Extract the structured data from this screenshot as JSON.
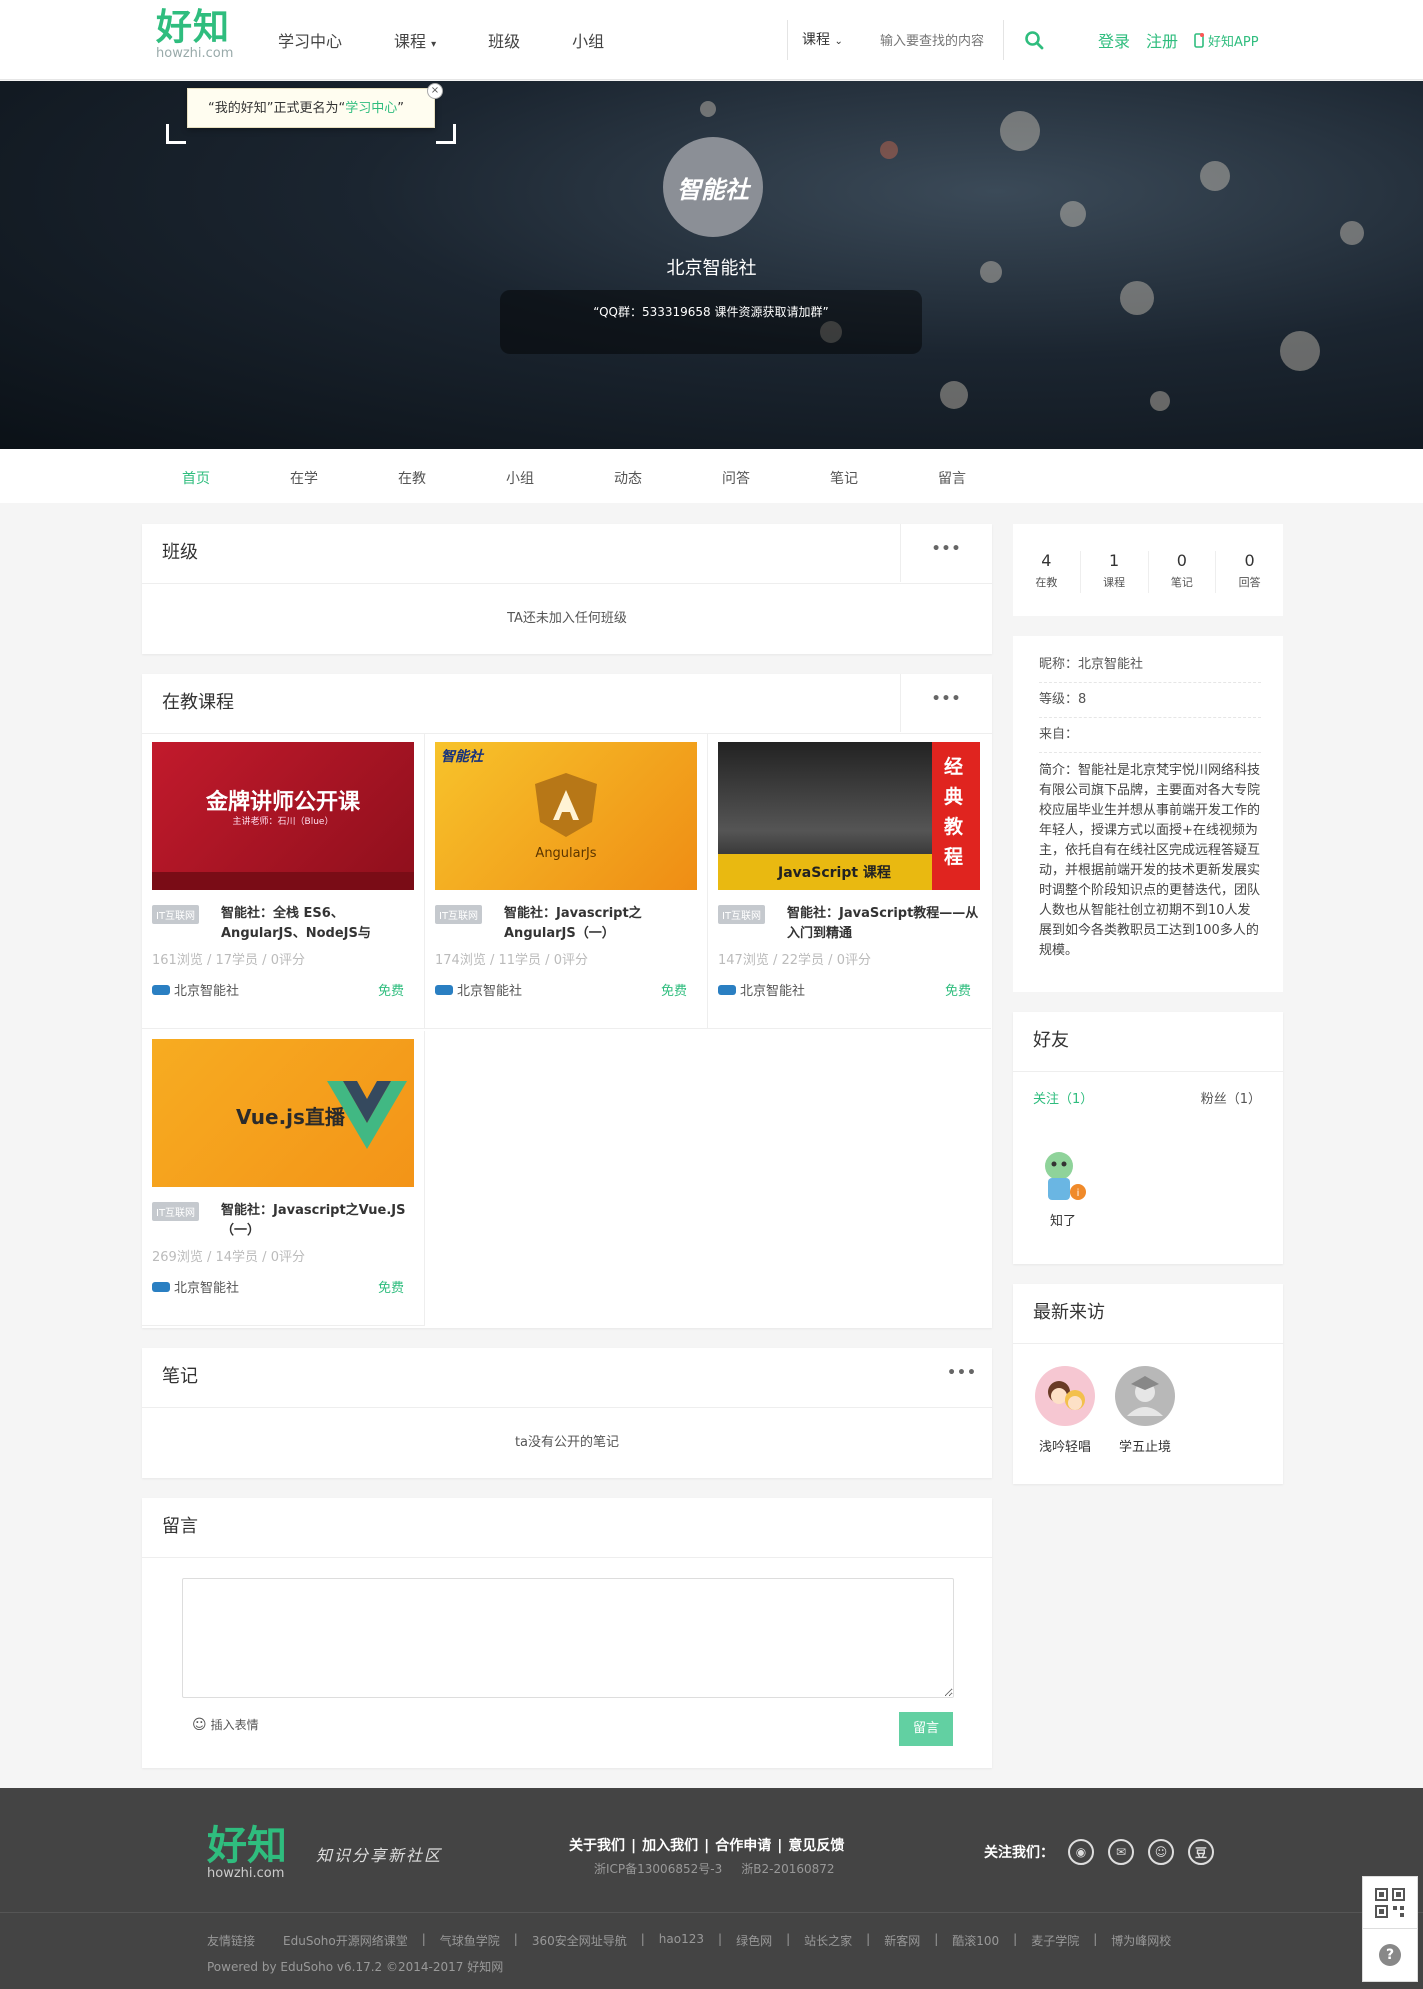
{
  "header": {
    "logo": "好知",
    "logo_sub": "howzhi.com",
    "nav": [
      "学习中心",
      "课程",
      "班级",
      "小组"
    ],
    "nav_course_has_dropdown": true,
    "search_type": "课程",
    "search_placeholder": "输入要查找的内容",
    "login": "登录",
    "register": "注册",
    "app": "好知APP"
  },
  "banner": {
    "tip_prefix": "“我的好知”正式更名为“",
    "tip_link": "学习中心",
    "tip_suffix": "”",
    "tip_close": "×",
    "avatar_text": "智能社",
    "username": "北京智能社",
    "signature": "“QQ群：533319658 课件资源获取请加群”"
  },
  "tabs": [
    "首页",
    "在学",
    "在教",
    "小组",
    "动态",
    "问答",
    "笔记",
    "留言"
  ],
  "class_section": {
    "title": "班级",
    "more": "•••",
    "empty": "TA还未加入任何班级"
  },
  "teach_section": {
    "title": "在教课程",
    "more": "•••",
    "courses": [
      {
        "tag": "IT互联网",
        "title": "智能社：全栈 ES6、AngularJS、NodeJS与",
        "views": "161浏览",
        "members": "17学员",
        "ratings": "0评分",
        "teacher": "北京智能社",
        "price": "免费",
        "img_title": "金牌讲师公开课",
        "img_sub": "主讲老师：石川（Blue）",
        "img_bg": "#c71c2c"
      },
      {
        "tag": "IT互联网",
        "title": "智能社：Javascript之AngularJS（一）",
        "views": "174浏览",
        "members": "11学员",
        "ratings": "0评分",
        "teacher": "北京智能社",
        "price": "免费",
        "img_title": "AngularJs",
        "img_sub": "智能社",
        "img_bg": "#f4a81f"
      },
      {
        "tag": "IT互联网",
        "title": "智能社：JavaScript教程——从入门到精通",
        "views": "147浏览",
        "members": "22学员",
        "ratings": "0评分",
        "teacher": "北京智能社",
        "price": "免费",
        "img_title": "JavaScript 课程",
        "img_sub": "经典教程",
        "img_bg": "#1a1a1a"
      },
      {
        "tag": "IT互联网",
        "title": "智能社：Javascript之Vue.JS（一）",
        "views": "269浏览",
        "members": "14学员",
        "ratings": "0评分",
        "teacher": "北京智能社",
        "price": "免费",
        "img_title": "Vue.js直播",
        "img_sub": "",
        "img_bg": "#f5a11d"
      }
    ]
  },
  "notes_section": {
    "title": "笔记",
    "more": "•••",
    "empty": "ta没有公开的笔记"
  },
  "message_section": {
    "title": "留言",
    "emoji": "插入表情",
    "submit": "留言"
  },
  "stats": [
    {
      "n": "4",
      "l": "在教"
    },
    {
      "n": "1",
      "l": "课程"
    },
    {
      "n": "0",
      "l": "笔记"
    },
    {
      "n": "0",
      "l": "回答"
    }
  ],
  "profile": {
    "nickname": "昵称：北京智能社",
    "level": "等级：8",
    "from": "来自：",
    "intro": "简介：智能社是北京梵宇悦川网络科技有限公司旗下品牌，主要面对各大专院校应届毕业生并想从事前端开发工作的年轻人，授课方式以面授+在线视频为主，依托自有在线社区完成远程答疑互动，并根据前端开发的技术更新发展实时调整个阶段知识点的更替迭代，团队人数也从智能社创立初期不到10人发展到如今各类教职员工达到100多人的规模。"
  },
  "friends": {
    "title": "好友",
    "follow": "关注（1）",
    "fans": "粉丝（1）",
    "items": [
      {
        "name": "知了"
      }
    ]
  },
  "visitors": {
    "title": "最新来访",
    "items": [
      {
        "name": "浅吟轻唱"
      },
      {
        "name": "学五止境"
      }
    ]
  },
  "footer": {
    "logo": "好知",
    "logo_sub": "howzhi.com",
    "slogan": "知识分享新社区",
    "links": [
      "关于我们",
      "加入我们",
      "合作申请",
      "意见反馈"
    ],
    "icp": "浙ICP备13006852号-3",
    "icp2": "浙B2-20160872",
    "follow": "关注我们：",
    "partners": [
      "友情链接",
      "EduSoho开源网络课堂",
      "气球鱼学院",
      "360安全网址导航",
      "hao123",
      "绿色网",
      "站长之家",
      "新客网",
      "酷滚100",
      "麦子学院",
      "博为峰网校"
    ],
    "powered": "Powered by EduSoho v6.17.2 ©2014-2017  好知网"
  }
}
